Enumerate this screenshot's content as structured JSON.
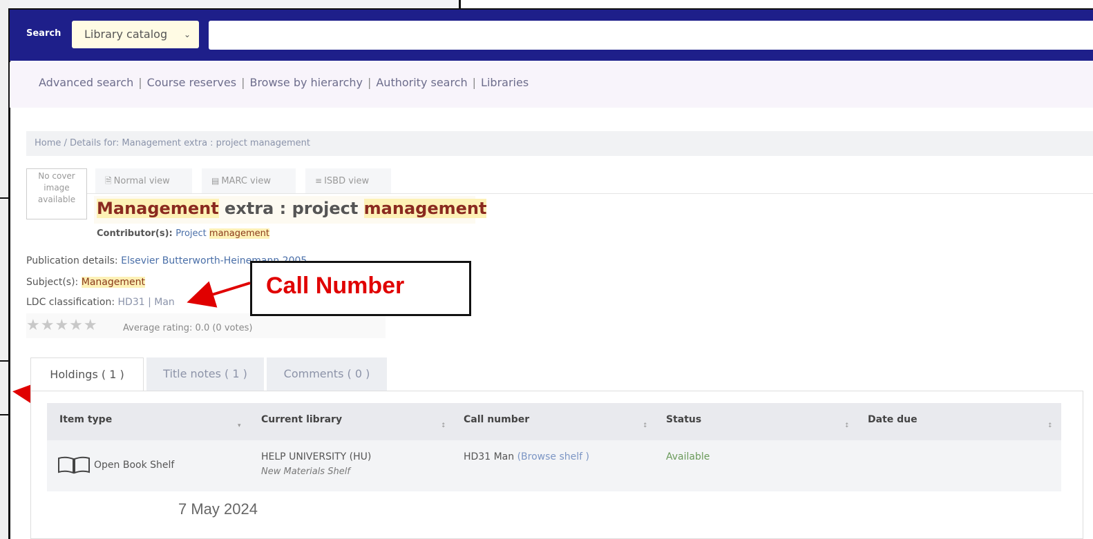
{
  "search": {
    "label": "Search",
    "select_value": "Library catalog",
    "input_value": ""
  },
  "nav_links": [
    "Advanced search",
    "Course reserves",
    "Browse by hierarchy",
    "Authority search",
    "Libraries"
  ],
  "breadcrumb": "Home / Details for: Management extra : project management",
  "cover": {
    "line1": "No cover",
    "line2": "image",
    "line3": "available"
  },
  "views": {
    "normal": "Normal view",
    "marc": "MARC view",
    "isbd": "ISBD view"
  },
  "record": {
    "title_part1": "Management",
    "title_part2": " extra : project ",
    "title_part3": "management",
    "contrib_label": "Contributor(s): ",
    "contrib_value1": "Project ",
    "contrib_value2": "management",
    "pub_label": "Publication details: ",
    "pub_value": "Elsevier Butterworth-Heinemann 2005",
    "subj_label": "Subject(s): ",
    "subj_value": "Management",
    "ldc_label": "LDC classification: ",
    "ldc_value": "HD31 | Man",
    "stars": "★★★★★",
    "rating_text": "Average rating: 0.0 (0 votes)"
  },
  "annotation": {
    "label": "Call Number"
  },
  "tabs": [
    "Holdings ( 1 )",
    "Title notes ( 1 )",
    "Comments ( 0 )"
  ],
  "holdings": {
    "headers": [
      "Item type",
      "Current library",
      "Call number",
      "Status",
      "Date due"
    ],
    "row": {
      "item_type": "Open Book Shelf",
      "library": "HELP UNIVERSITY (HU)",
      "library_sub": "New Materials Shelf",
      "call_number": "HD31 Man",
      "browse": "(Browse shelf )",
      "status": "Available",
      "date_due": ""
    }
  },
  "footer_date": "7 May 2024",
  "colors": {
    "header_bg": "#1e1f8a",
    "annotation_red": "#e00000",
    "highlight": "#fdf1b6"
  }
}
